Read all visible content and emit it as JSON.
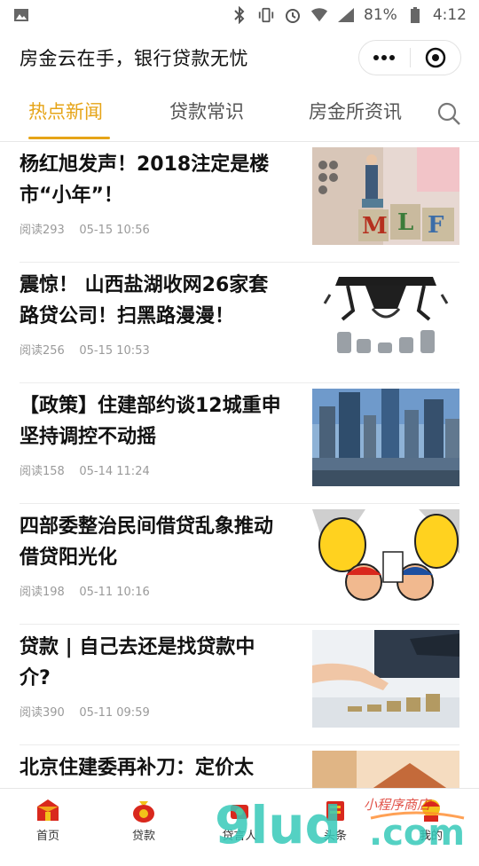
{
  "status_bar": {
    "battery": "81%",
    "time": "4:12",
    "icons": [
      "image-icon",
      "bluetooth-icon",
      "vibrate-icon",
      "alarm-icon",
      "wifi-icon",
      "signal-icon",
      "battery-icon"
    ]
  },
  "header": {
    "title": "房金云在手，银行贷款无忧",
    "more_icon": "more-dots-icon",
    "close_icon": "mini-program-close-icon"
  },
  "tabs": [
    {
      "label": "热点新闻",
      "active": true
    },
    {
      "label": "贷款常识",
      "active": false
    },
    {
      "label": "房金所资讯",
      "active": false
    }
  ],
  "search_icon": "search-icon",
  "articles": [
    {
      "title": "杨红旭发声！2018注定是楼市“小年”！",
      "views": "阅读293",
      "date": "05-15 10:56",
      "thumb": "abacus-mlf-blocks"
    },
    {
      "title": "震惊！ 山西盐湖收网26家套路贷公司！扫黑路漫漫！",
      "views": "阅读256",
      "date": "05-15 10:53",
      "thumb": "claws-coins"
    },
    {
      "title": "【政策】住建部约谈12城重申坚持调控不动摇",
      "views": "阅读158",
      "date": "05-14 11:24",
      "thumb": "city-skyline"
    },
    {
      "title": "四部委整治民间借贷乱象推动借贷阳光化",
      "views": "阅读198",
      "date": "05-11 10:16",
      "thumb": "loan-cartoon"
    },
    {
      "title": "贷款 | 自己去还是找贷款中介?",
      "views": "阅读390",
      "date": "05-11 09:59",
      "thumb": "hand-coins"
    },
    {
      "title": "北京住建委再补刀：定价太",
      "views": "",
      "date": "",
      "thumb": "house-model"
    }
  ],
  "bottom_nav": [
    {
      "label": "首页",
      "icon": "home-icon"
    },
    {
      "label": "贷款",
      "icon": "money-bag-icon"
    },
    {
      "label": "贷言人",
      "icon": "speaker-icon"
    },
    {
      "label": "头条",
      "icon": "headline-icon"
    },
    {
      "label": "我的",
      "icon": "profile-icon"
    }
  ],
  "watermark": {
    "brand": "9lud.com",
    "slogan": "小程序商店"
  },
  "colors": {
    "accent": "#e6a417",
    "nav_red": "#d9281d"
  }
}
